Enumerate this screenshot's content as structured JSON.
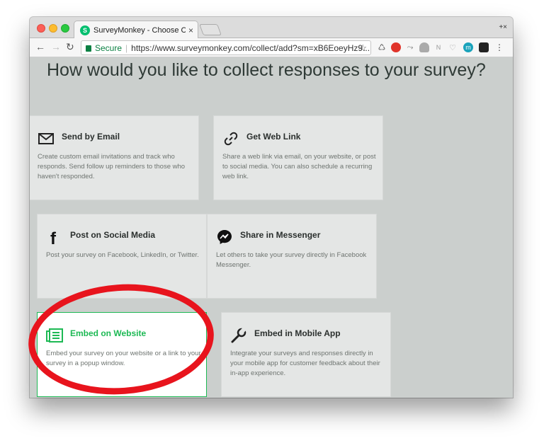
{
  "browser": {
    "tab_title": "SurveyMonkey - Choose Colle",
    "tab_close": "×",
    "profile_button": "+×",
    "url_secure": "Secure",
    "url": "https://www.surveymonkey.com/collect/add?sm=xB6EoeyHz9...",
    "favicon_letter": "S",
    "accent_color": "#00bf6f"
  },
  "page": {
    "title": "How would you like to collect responses to your survey?"
  },
  "cards": [
    {
      "title": "Send by Email",
      "icon": "envelope-icon",
      "desc": "Create custom email invitations and track who responds. Send follow up reminders to those who haven't responded."
    },
    {
      "title": "Get Web Link",
      "icon": "link-icon",
      "desc": "Share a web link via email, on your website, or post to social media. You can also schedule a recurring web link."
    },
    {
      "title": "Post on Social Media",
      "icon": "facebook-icon",
      "desc": "Post your survey on Facebook, LinkedIn, or Twitter."
    },
    {
      "title": "Share in Messenger",
      "icon": "messenger-icon",
      "desc": "Let others to take your survey directly in Facebook Messenger."
    },
    {
      "title": "Embed on Website",
      "icon": "embed-icon",
      "desc": "Embed your survey on your website or a link to your survey in a popup window.",
      "highlight_color": "#1db954"
    },
    {
      "title": "Embed in Mobile App",
      "icon": "wrench-icon",
      "desc": "Integrate your surveys and responses directly in your mobile app for customer feedback about their in-app experience."
    }
  ],
  "annotation_color": "#e8141d"
}
